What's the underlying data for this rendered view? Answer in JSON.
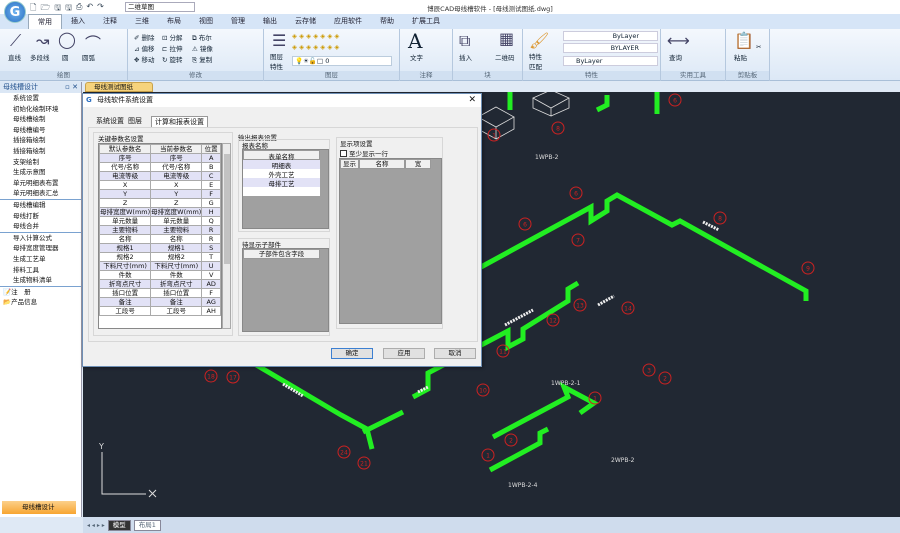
{
  "app": {
    "title": "博辰CAD母线槽软件 - [母线测试图纸.dwg]",
    "workspace": "二维草图",
    "logo": "G"
  },
  "tabs": [
    "常用",
    "插入",
    "注释",
    "三维",
    "布局",
    "视图",
    "管理",
    "输出",
    "云存储",
    "应用软件",
    "帮助",
    "扩展工具"
  ],
  "ribbon": {
    "draw": {
      "label": "绘图",
      "tools": [
        "直线",
        "多段线",
        "圆",
        "圆弧"
      ]
    },
    "modify": {
      "label": "修改",
      "tools": [
        "删除",
        "分解",
        "布尔",
        "偏移",
        "拉伸",
        "镜像",
        "移动",
        "旋转",
        "复制"
      ]
    },
    "layer": {
      "label": "图层",
      "tool": "图层特性",
      "current": "0"
    },
    "annot": {
      "label": "注释",
      "tool": "文字"
    },
    "block": {
      "label": "块",
      "tools": [
        "插入",
        "二维码"
      ]
    },
    "props": {
      "label": "特性",
      "tool": "特性匹配",
      "linetype": "ByLayer",
      "lineweight": "BYLAYER",
      "color": "ByLayer"
    },
    "util": {
      "label": "实用工具",
      "tool": "查询"
    },
    "clip": {
      "label": "剪贴板",
      "tool": "粘贴"
    }
  },
  "left_panel": {
    "title": "母线槽设计",
    "items": [
      "系统设置",
      "初始化绘制环境",
      "母线槽绘制",
      "母线槽编号",
      "插接箱绘制",
      "插接箱绘制",
      "支架绘制",
      "生成示意图",
      "单元明细表布置",
      "单元明细表汇总"
    ],
    "items2": [
      "母线槽编辑",
      "母线打断",
      "母线合并"
    ],
    "items3": [
      "导入计算公式",
      "母排宽度管理器",
      "生成工艺单",
      "排料工具",
      "生成物料清单"
    ],
    "items4": [
      "注　册",
      "产品信息"
    ],
    "footer": "母线槽设计"
  },
  "doc_tab": "母线测试图纸",
  "layout_tabs": [
    "模型",
    "布局1"
  ],
  "dialog": {
    "title": "母线软件系统设置",
    "tabs": [
      "系统设置",
      "图层",
      "计算和报表设置"
    ],
    "key_params": {
      "label": "关键参数名设置",
      "headers": [
        "默认参数名",
        "当前参数名",
        "位置"
      ],
      "rows": [
        [
          "序号",
          "序号",
          "A"
        ],
        [
          "代号/名称",
          "代号/名称",
          "B"
        ],
        [
          "电流等级",
          "电流等级",
          "C"
        ],
        [
          "X",
          "X",
          "E"
        ],
        [
          "Y",
          "Y",
          "F"
        ],
        [
          "Z",
          "Z",
          "G"
        ],
        [
          "母排宽度W(mm)",
          "母排宽度W(mm)",
          "H"
        ],
        [
          "单元数量",
          "单元数量",
          "Q"
        ],
        [
          "主要物料",
          "主要物料",
          "R"
        ],
        [
          "名称",
          "名称",
          "R"
        ],
        [
          "规格1",
          "规格1",
          "S"
        ],
        [
          "规格2",
          "规格2",
          "T"
        ],
        [
          "下料尺寸(mm)",
          "下料尺寸(mm)",
          "U"
        ],
        [
          "件数",
          "件数",
          "V"
        ],
        [
          "折弯点尺寸",
          "折弯点尺寸",
          "AD"
        ],
        [
          "插口位置",
          "插口位置",
          "F"
        ],
        [
          "备注",
          "备注",
          "AG"
        ],
        [
          "工段号",
          "工段号",
          "AH"
        ]
      ]
    },
    "output": {
      "label": "输出报表设置",
      "report_label": "报表名称",
      "report_header": "表单名称",
      "reports": [
        "明细表",
        "外壳工艺",
        "母排工艺"
      ]
    },
    "display": {
      "label": "显示项设置",
      "checkbox": "至少显示一行",
      "checked": false,
      "headers": [
        "显示",
        "名称",
        "宽"
      ]
    },
    "sub": {
      "label": "待显示子部件",
      "header": "子部件包含字段"
    },
    "buttons": {
      "ok": "确定",
      "apply": "应用",
      "cancel": "取消"
    }
  },
  "drawing": {
    "labels": [
      "1WPB-2",
      "1WPB-2-1",
      "2WPB-2",
      "1WPB-2-4"
    ],
    "markers": [
      "1",
      "8",
      "6",
      "6",
      "6",
      "7",
      "8",
      "9",
      "12",
      "13",
      "14",
      "11",
      "10",
      "18",
      "17",
      "24",
      "21",
      "3",
      "2",
      "1",
      "2",
      "1"
    ],
    "axis": [
      "Y",
      "X"
    ],
    "colors": {
      "bus": "#22ee22",
      "marker": "#cc2222",
      "bg": "#212833"
    }
  }
}
